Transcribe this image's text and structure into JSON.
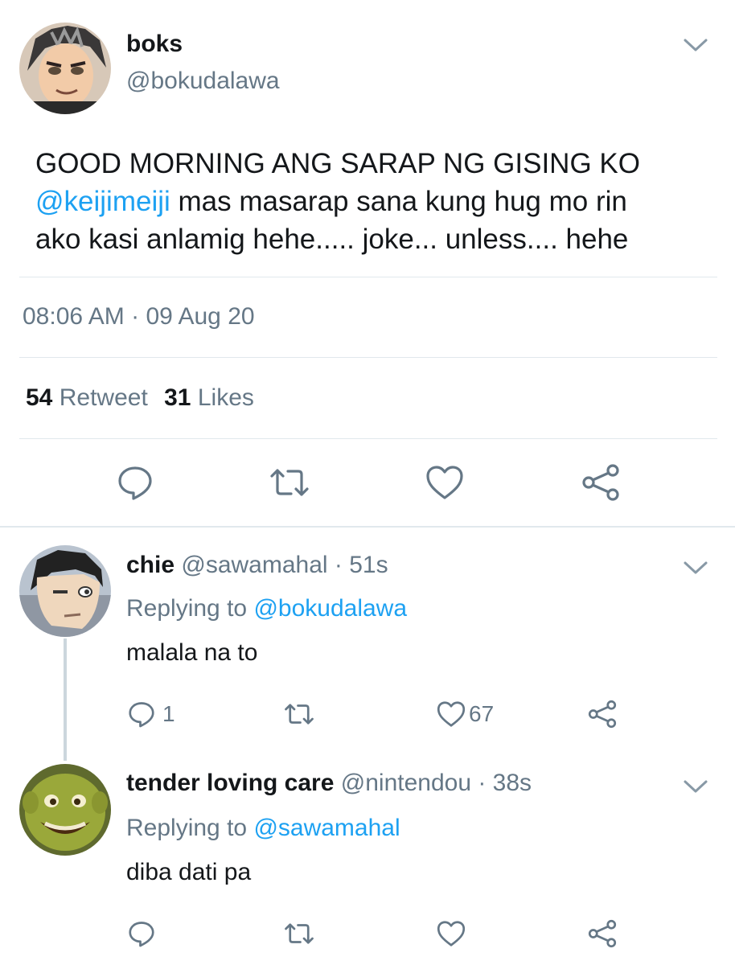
{
  "main_tweet": {
    "display_name": "boks",
    "handle": "@bokudalawa",
    "text_line1": "GOOD MORNING ANG SARAP NG GISING KO",
    "mention": "@keijimeiji",
    "text_line2_rest": " mas masarap sana kung hug mo rin",
    "text_line3": "ako kasi anlamig hehe..... joke... unless.... hehe",
    "time": "08:06 AM",
    "date_sep": " · ",
    "date": "09 Aug 20",
    "retweet_count": "54",
    "retweet_label": "Retweet",
    "like_count": "31",
    "like_label": "Likes"
  },
  "replies": [
    {
      "display_name": "chie",
      "handle": "@sawamahal",
      "time": " · 51s",
      "replying_label": "Replying to ",
      "replying_to": "@bokudalawa",
      "text": "malala na to",
      "reply_count": "1",
      "like_count": "67"
    },
    {
      "display_name": "tender loving care",
      "handle": "@nintendou",
      "time": " · 38s",
      "replying_label": "Replying to ",
      "replying_to": "@sawamahal",
      "text": "diba dati pa"
    }
  ],
  "colors": {
    "link": "#1da1f2",
    "muted": "#657786",
    "icon": "#657786",
    "divider": "#e1e8ed",
    "thread_line": "#ccd6dd"
  },
  "icons": [
    "chevron-down-icon",
    "reply-icon",
    "retweet-icon",
    "like-icon",
    "share-icon"
  ]
}
